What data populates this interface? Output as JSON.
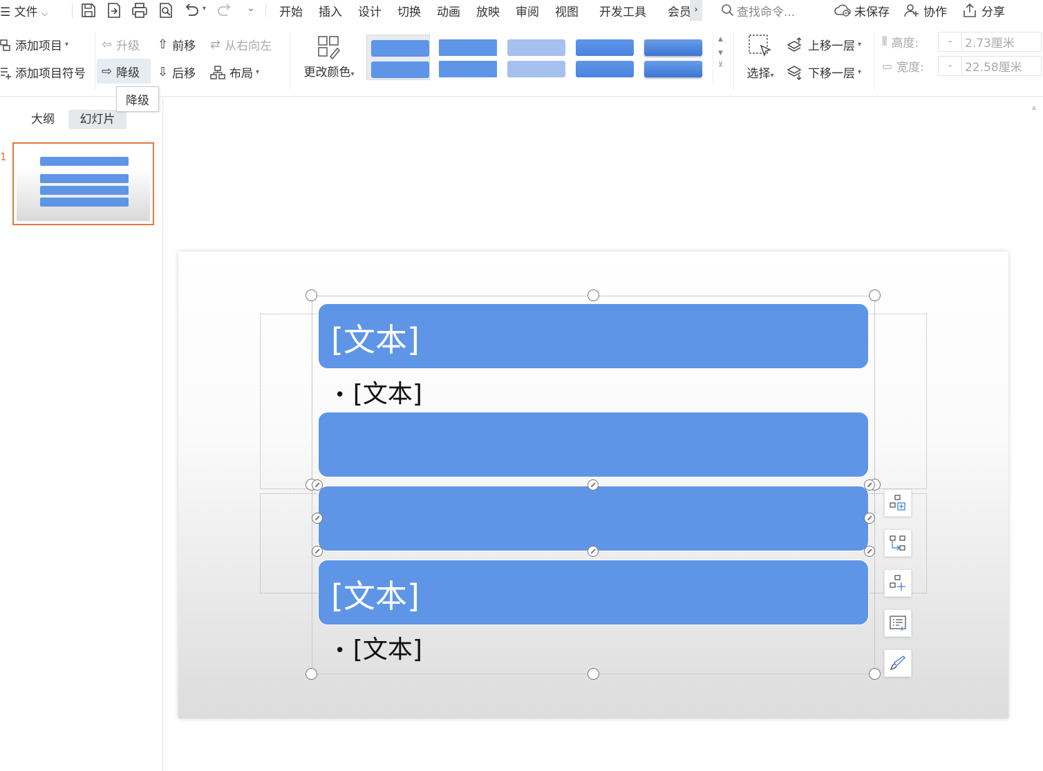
{
  "menubar": {
    "file_label": "文件",
    "tabs": [
      "开始",
      "插入",
      "设计",
      "切换",
      "动画",
      "放映",
      "审阅",
      "视图",
      "开发工具",
      "会员"
    ],
    "search_placeholder": "查找命令...",
    "unsaved_label": "未保存",
    "collab_label": "协作",
    "share_label": "分享"
  },
  "ribbon": {
    "add_item": "添加项目",
    "add_bullet": "添加项目符号",
    "promote": "升级",
    "demote": "降级",
    "move_up": "前移",
    "move_down": "后移",
    "right_to_left": "从右向左",
    "layout": "布局",
    "change_color": "更改颜色",
    "select": "选择",
    "bring_forward": "上移一层",
    "send_backward": "下移一层",
    "height_label": "高度:",
    "height_value": "2.73厘米",
    "width_label": "宽度:",
    "width_value": "22.58厘米",
    "minus": "-",
    "tooltip": "降级"
  },
  "styles_gallery": [
    {
      "top_color": "#5f95e6",
      "bottom_color": "#5f95e6",
      "selected": true
    },
    {
      "top_color": "#5f95e6",
      "bottom_color": "#5f95e6",
      "selected": false
    },
    {
      "top_color": "#a6c1ef",
      "bottom_color": "#a6c1ef",
      "selected": false
    },
    {
      "top_color": "#4a84e0",
      "bottom_color": "#4a84e0",
      "selected": false
    },
    {
      "top_color": "#4a84e0",
      "bottom_color": "#4a84e0",
      "selected": false
    }
  ],
  "leftpanel": {
    "tab_outline": "大纲",
    "tab_slides": "幻灯片",
    "slide_number": "1"
  },
  "slide": {
    "box1_text": "[文本]",
    "bullet1_text": "[文本]",
    "box4_text": "[文本]",
    "bullet2_text": "[文本]",
    "bullet_char": "•"
  },
  "colors": {
    "accent_blue": "#5f95e6",
    "selection_orange": "#e07a3c"
  }
}
